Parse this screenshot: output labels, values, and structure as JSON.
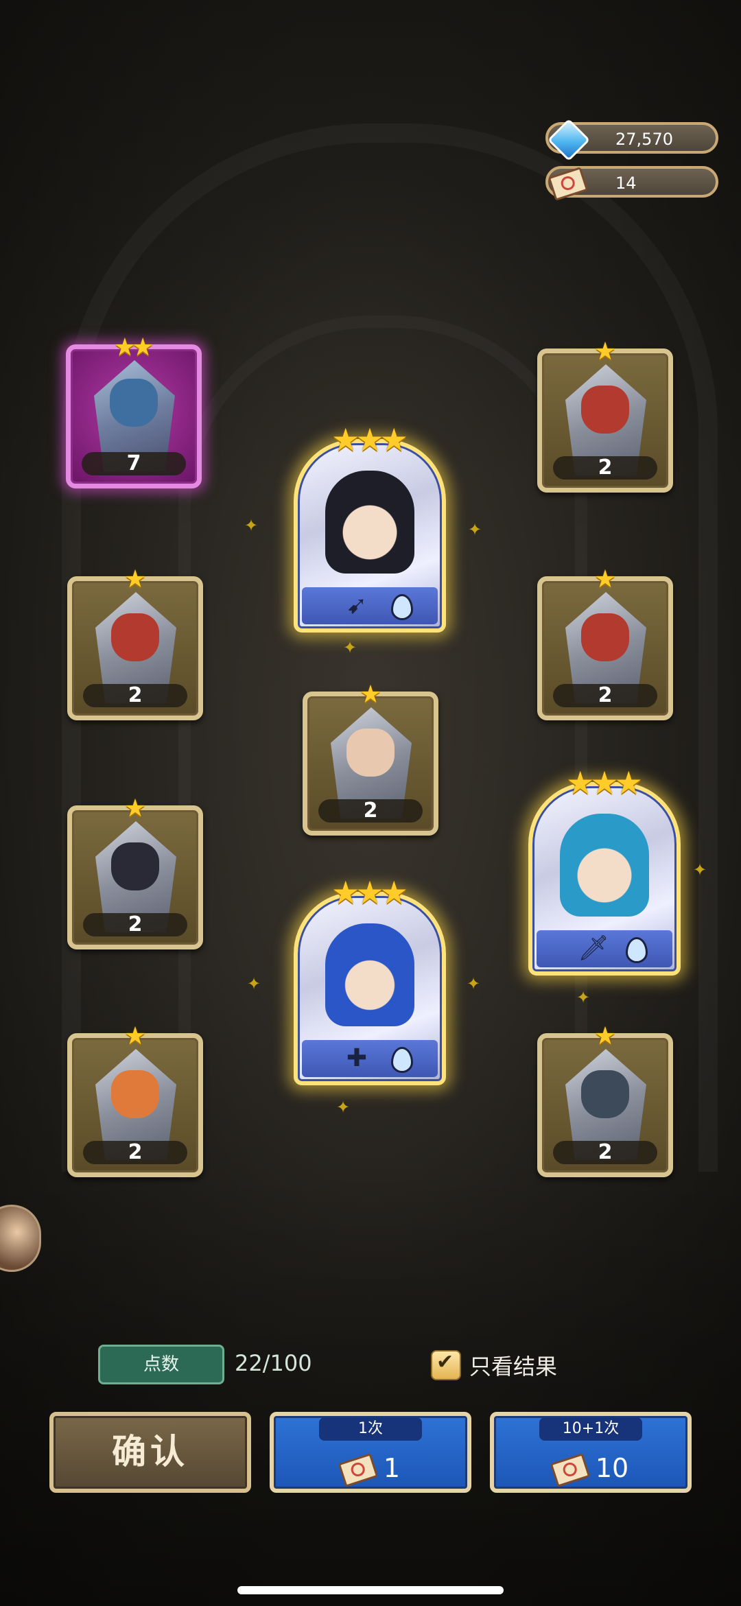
{
  "currency": {
    "gems": "27,570",
    "tickets": "14"
  },
  "cards": [
    {
      "id": "c1",
      "stars": 2,
      "count": "7",
      "rarity": "purple",
      "face": "#3f6fa0"
    },
    {
      "id": "c2",
      "stars": 1,
      "count": "2",
      "rarity": "normal",
      "face": "#b33a2e"
    },
    {
      "id": "c3",
      "stars": 1,
      "count": "2",
      "rarity": "normal",
      "face": "#b33a2e"
    },
    {
      "id": "c4",
      "stars": 1,
      "count": "2",
      "rarity": "normal",
      "face": "#b33a2e"
    },
    {
      "id": "c5",
      "stars": 1,
      "count": "2",
      "rarity": "normal",
      "face": "#e8c9b0"
    },
    {
      "id": "c6",
      "stars": 1,
      "count": "2",
      "rarity": "normal",
      "face": "#2a2a36"
    },
    {
      "id": "c7",
      "stars": 1,
      "count": "2",
      "rarity": "normal",
      "face": "#e07a3a"
    },
    {
      "id": "c8",
      "stars": 1,
      "count": "2",
      "rarity": "normal",
      "face": "#3d4a5a"
    }
  ],
  "big_cards": [
    {
      "id": "b1",
      "stars": 3,
      "class_icon": "bow-icon",
      "element_icon": "water-drop-icon",
      "hair": "#1e1e28"
    },
    {
      "id": "b2",
      "stars": 3,
      "class_icon": "sword-icon",
      "element_icon": "water-drop-icon",
      "hair": "#2a9ac8"
    },
    {
      "id": "b3",
      "stars": 3,
      "class_icon": "cross-icon",
      "element_icon": "water-drop-icon",
      "hair": "#2a56c8"
    }
  ],
  "bottom": {
    "points_label": "点数",
    "points_value": "22/100",
    "only_results": "只看结果",
    "confirm": "确认",
    "draw1_tag": "1次",
    "draw1_cost": "1",
    "draw10_tag": "10+1次",
    "draw10_cost": "10"
  },
  "colors": {
    "gold_star": "#ffcc2a",
    "draw_button": "#2e73d6",
    "points_badge": "#2c6a55"
  }
}
